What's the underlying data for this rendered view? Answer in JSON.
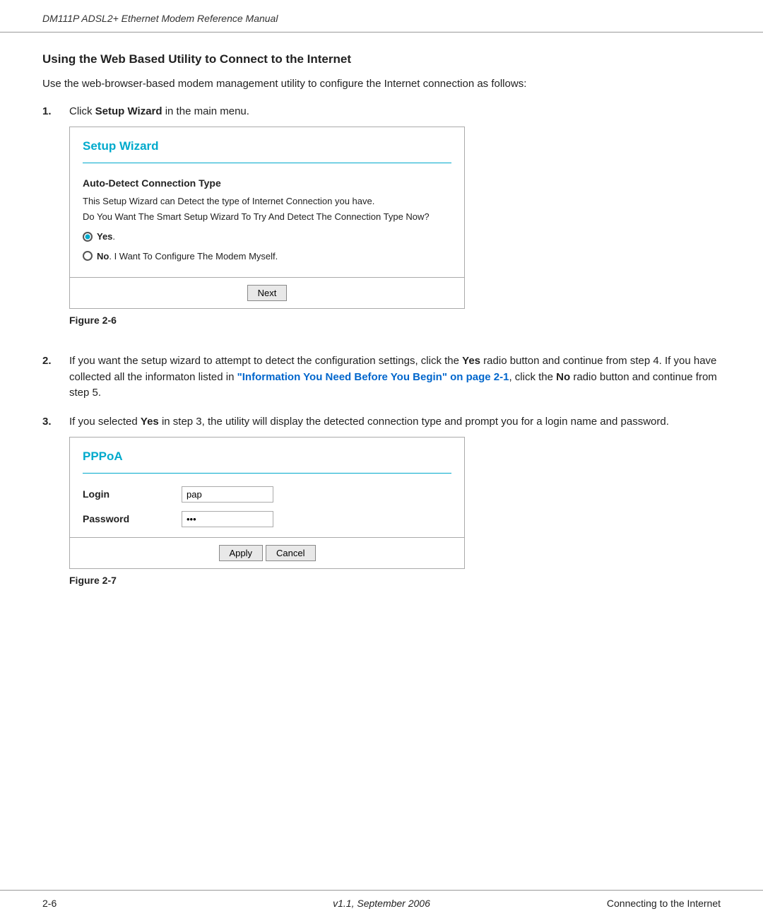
{
  "header": {
    "text": "DM111P ADSL2+ Ethernet Modem Reference Manual"
  },
  "section": {
    "title": "Using the Web Based Utility to Connect to the Internet",
    "intro": "Use the web-browser-based modem management utility to configure the Internet connection as follows:"
  },
  "steps": [
    {
      "num": "1.",
      "text_plain": "Click ",
      "text_bold": "Setup Wizard",
      "text_suffix": " in the main menu."
    },
    {
      "num": "2.",
      "text": "If you want the setup wizard to attempt to detect the configuration settings, click the ",
      "bold1": "Yes",
      "text2": " radio button and continue from step 4. If you have collected all the informaton listed in ",
      "link": "\"Information You Need Before You Begin\" on page 2-1",
      "text3": ", click the ",
      "bold2": "No",
      "text4": " radio button and continue from step 5."
    },
    {
      "num": "3.",
      "text": "If you selected ",
      "bold1": "Yes",
      "text2": " in step 3, the utility will display the detected connection type and prompt you for a login name and password."
    }
  ],
  "setup_wizard_box": {
    "title": "Setup Wizard",
    "section_heading": "Auto-Detect Connection Type",
    "desc1": "This Setup Wizard can Detect the type of Internet Connection you have.",
    "desc2": "Do You Want The Smart Setup Wizard To Try And Detect The Connection Type Now?",
    "radio_yes_label": "Yes",
    "radio_yes_suffix": ".",
    "radio_no_label": "No",
    "radio_no_suffix": ". I Want To Configure The Modem Myself.",
    "button_next": "Next"
  },
  "figure6_label": "Figure 2-6",
  "pppoa_box": {
    "title": "PPPoA",
    "login_label": "Login",
    "login_value": "pap",
    "password_label": "Password",
    "password_value": "•••",
    "button_apply": "Apply",
    "button_cancel": "Cancel"
  },
  "figure7_label": "Figure 2-7",
  "footer": {
    "page_num": "2-6",
    "version": "v1.1, September 2006",
    "section": "Connecting to the Internet"
  }
}
